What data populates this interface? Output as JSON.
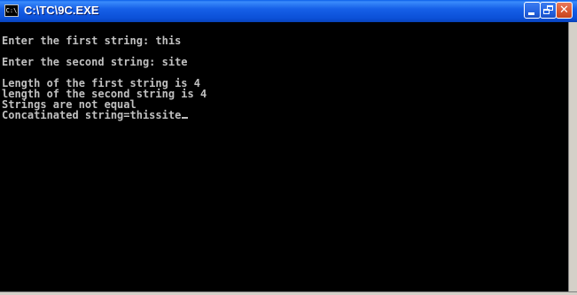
{
  "window": {
    "title": "C:\\TC\\9C.EXE",
    "icon_text": "C:\\",
    "controls": {
      "minimize": "minimize-icon",
      "maximize": "restore-icon",
      "close": "close-icon",
      "close_glyph": "✕"
    }
  },
  "console": {
    "lines": [
      "",
      "Enter the first string: this",
      "",
      "Enter the second string: site",
      "",
      "Length of the first string is 4",
      "length of the second string is 4",
      "Strings are not equal",
      "Concatinated string=thissite"
    ],
    "text_color": "#c0c0c0",
    "background_color": "#000000"
  }
}
